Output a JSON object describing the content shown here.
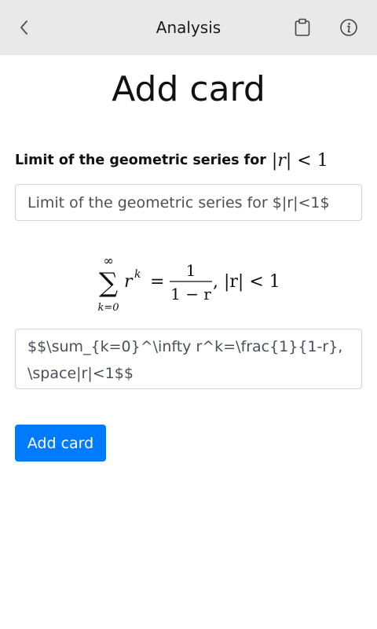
{
  "header": {
    "title": "Analysis",
    "icons": {
      "back": "chevron-left-icon",
      "clipboard": "clipboard-icon",
      "info": "info-icon"
    }
  },
  "page": {
    "title": "Add card"
  },
  "front": {
    "label": "Limit of the geometric series for",
    "label_math": {
      "bar_left": "|",
      "var": "r",
      "bar_right": "|",
      "rest": " < 1"
    },
    "input_value": "Limit of the geometric series for $|r|<1$"
  },
  "back": {
    "rendered": {
      "sum_upper": "∞",
      "sum_symbol": "∑",
      "sum_lower": "k=0",
      "term_base": "r",
      "term_exp": "k",
      "equals": "=",
      "numerator": "1",
      "denominator": "1 − r",
      "tail": ", |r| < 1"
    },
    "input_value": "$$\\sum_{k=0}^\\infty r^k=\\frac{1}{1-r}, \\space|r|<1$$"
  },
  "actions": {
    "add_label": "Add card"
  },
  "colors": {
    "header_bg": "#e9e9e9",
    "primary": "#007bff",
    "border": "#ced4da"
  }
}
